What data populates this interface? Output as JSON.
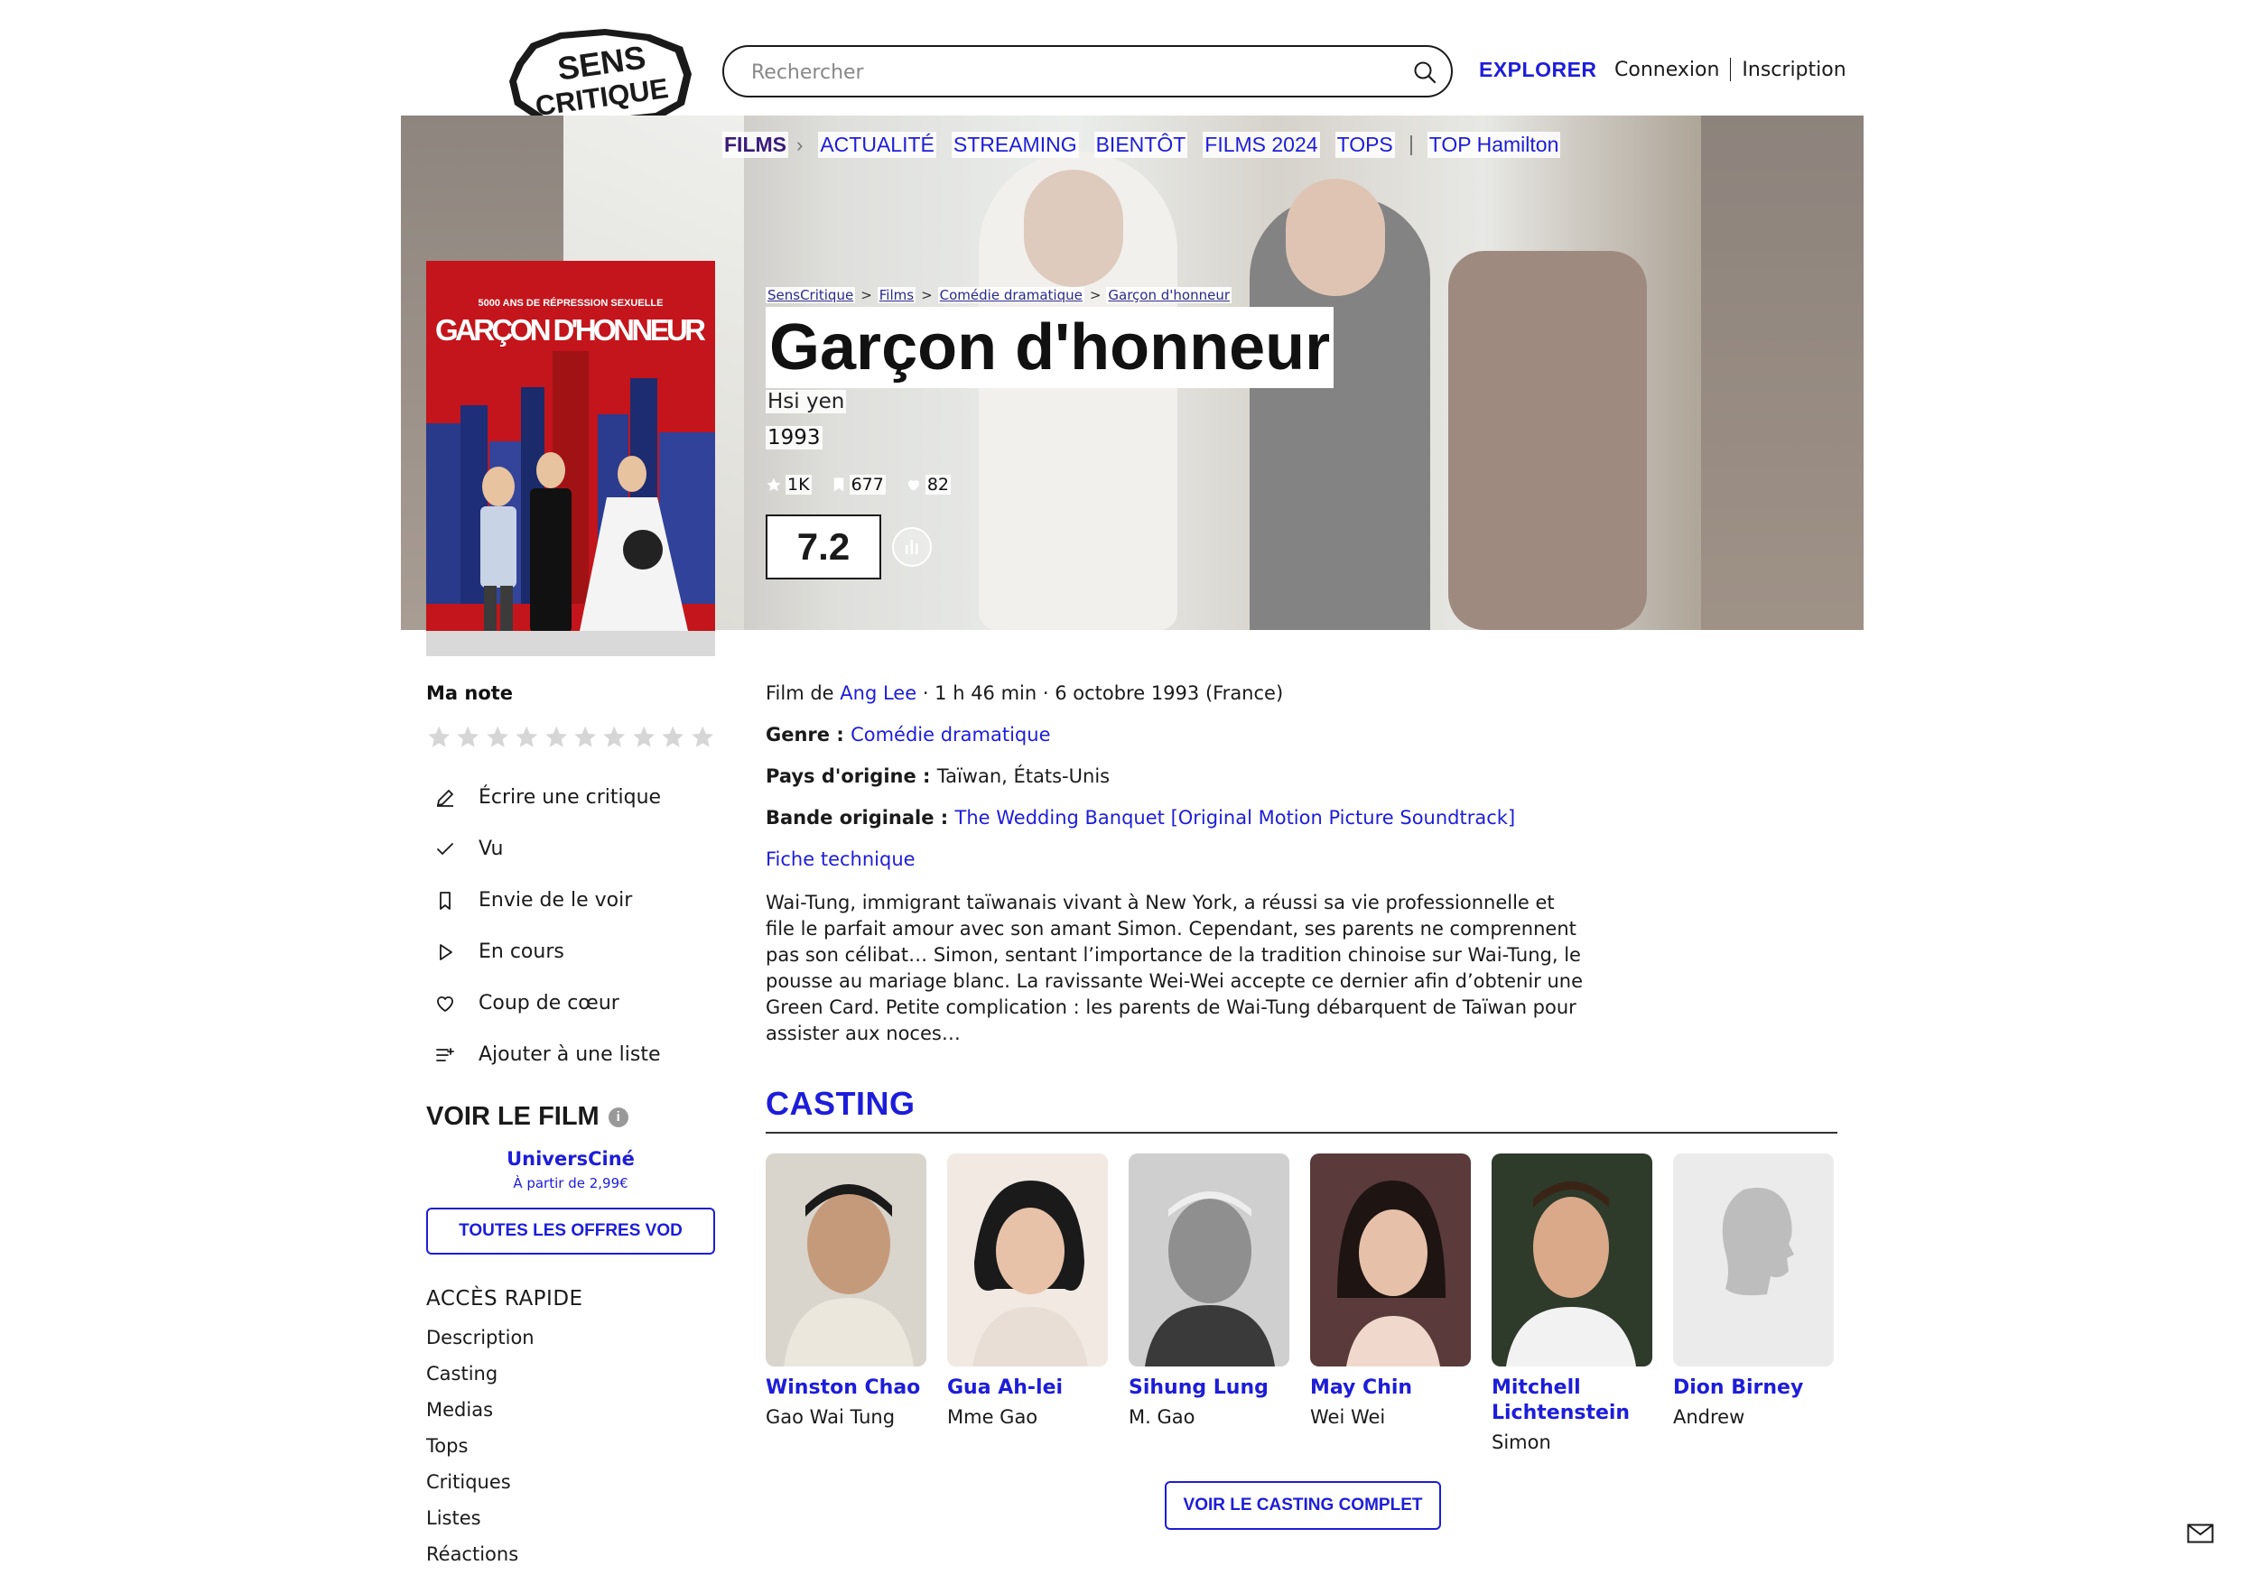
{
  "header": {
    "logo_line1": "SENS",
    "logo_line2": "CRITIQUE",
    "search_placeholder": "Rechercher",
    "explorer_label": "EXPLORER",
    "login_label": "Connexion",
    "signup_label": "Inscription"
  },
  "nav": {
    "films": "FILMS",
    "items": [
      "ACTUALITÉ",
      "STREAMING",
      "BIENTÔT",
      "FILMS 2024",
      "TOPS"
    ],
    "top_hamilton": "TOP Hamilton"
  },
  "poster": {
    "tagline": "5000 ANS DE RÉPRESSION SEXUELLE",
    "title": "GARÇON D'HONNEUR"
  },
  "breadcrumb": [
    "SensCritique",
    "Films",
    "Comédie dramatique",
    "Garçon d'honneur"
  ],
  "film": {
    "title": "Garçon d'honneur",
    "original_title": "Hsi yen",
    "year": "1993",
    "stat_ratings": "1K",
    "stat_wishes": "677",
    "stat_favorites": "82",
    "score": "7.2"
  },
  "sidebar": {
    "ma_note": "Ma note",
    "stars_count": 10,
    "actions": [
      {
        "label": "Écrire une critique",
        "icon": "pencil-icon"
      },
      {
        "label": "Vu",
        "icon": "check-icon"
      },
      {
        "label": "Envie de le voir",
        "icon": "bookmark-icon"
      },
      {
        "label": "En cours",
        "icon": "play-icon"
      },
      {
        "label": "Coup de cœur",
        "icon": "heart-icon"
      },
      {
        "label": "Ajouter à une liste",
        "icon": "list-add-icon"
      }
    ],
    "voir_title": "VOIR LE FILM",
    "info_glyph": "i",
    "provider_name": "UniversCiné",
    "provider_price": "À partir de 2,99€",
    "vod_button": "TOUTES LES OFFRES VOD",
    "quick_title": "ACCÈS RAPIDE",
    "quick_links": [
      "Description",
      "Casting",
      "Medias",
      "Tops",
      "Critiques",
      "Listes",
      "Réactions"
    ]
  },
  "details": {
    "film_de": "Film de ",
    "director": "Ang Lee",
    "meta": " · 1 h 46 min · 6 octobre 1993 (France)",
    "genre_label": "Genre : ",
    "genre": "Comédie dramatique",
    "pays_label": "Pays d'origine : ",
    "pays": "Taïwan, États-Unis",
    "bo_label": "Bande originale : ",
    "bo": "The Wedding Banquet [Original Motion Picture Soundtrack]",
    "fiche": "Fiche technique",
    "synopsis": "Wai-Tung, immigrant taïwanais vivant à New York, a réussi sa vie professionnelle et file le parfait amour avec son amant Simon. Cependant, ses parents ne comprennent pas son célibat… Simon, sentant l’importance de la tradition chinoise sur Wai-Tung, le pousse au mariage blanc. La ravissante Wei-Wei accepte ce dernier afin d’obtenir une Green Card. Petite complication : les parents de Wai-Tung débarquent de Taïwan pour assister aux noces…"
  },
  "casting": {
    "title": "CASTING",
    "actors": [
      {
        "name": "Winston Chao",
        "role": "Gao Wai Tung"
      },
      {
        "name": "Gua Ah-lei",
        "role": "Mme Gao"
      },
      {
        "name": "Sihung Lung",
        "role": "M. Gao"
      },
      {
        "name": "May Chin",
        "role": "Wei Wei"
      },
      {
        "name": "Mitchell Lichtenstein",
        "role": "Simon"
      },
      {
        "name": "Dion Birney",
        "role": "Andrew"
      }
    ],
    "full_button": "VOIR LE CASTING COMPLET"
  },
  "colors": {
    "accent": "#1d1dd9",
    "poster_red": "#c3151b",
    "films_purple": "#3a1b7a"
  }
}
